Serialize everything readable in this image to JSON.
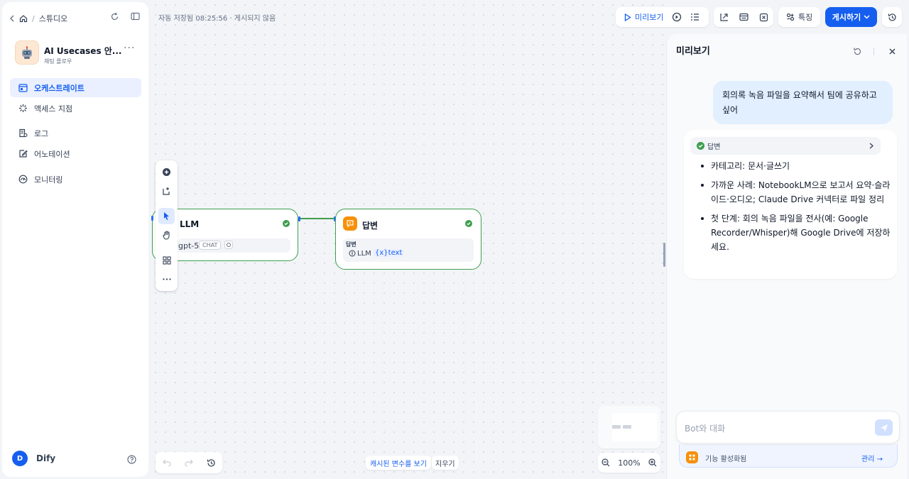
{
  "header": {
    "breadcrumb": "스튜디오",
    "save_status": "자동 저장됨 08:25:56 · 게시되지 않음",
    "preview_label": "미리보기",
    "features_label": "특징",
    "publish_label": "게시하기"
  },
  "app": {
    "name": "AI Usecases 안...",
    "type": "채팅 플로우"
  },
  "sidebar": {
    "items": [
      {
        "label": "오케스트레이트",
        "icon": "orchestrate-icon",
        "active": true
      },
      {
        "label": "액세스 지점",
        "icon": "access-point-icon",
        "active": false
      },
      {
        "label": "로그",
        "icon": "logs-icon",
        "active": false
      },
      {
        "label": "어노테이션",
        "icon": "annotation-icon",
        "active": false
      },
      {
        "label": "모니터링",
        "icon": "monitoring-icon",
        "active": false
      }
    ],
    "user_initial": "D",
    "user_name": "Dify"
  },
  "canvas": {
    "llm_node": {
      "title": "LLM",
      "model": "gpt-5",
      "badge": "CHAT"
    },
    "answer_node": {
      "title": "답변",
      "field_label": "답변",
      "var_source": "LLM",
      "var_name": "{x}text"
    },
    "cache_button": "캐시된 변수를 보기",
    "clear_button": "지우기",
    "zoom": "100%"
  },
  "preview": {
    "title": "미리보기",
    "user_message": "회의록 녹음 파일을 요약해서 팀에 공유하고 싶어",
    "workflow_label": "답변",
    "bullets": [
      "카테고리: 문서·글쓰기",
      "가까운 사례: NotebookLM으로 보고서 요약·슬라이드·오디오; Claude Drive 커넥터로 파일 정리",
      "첫 단계: 회의 녹음 파일을 전사(예: Google Recorder/Whisper)해 Google Drive에 저장하세요."
    ],
    "input_placeholder": "Bot와 대화",
    "feature_text": "기능 활성화됨",
    "manage_label": "관리 →"
  },
  "colors": {
    "accent": "#155eef",
    "success": "#3d9e4f",
    "answer_icon_bg": "#f79009"
  }
}
